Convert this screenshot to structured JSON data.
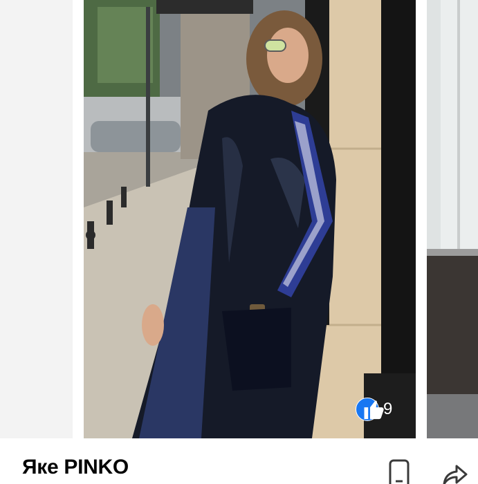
{
  "listing": {
    "title": "Яке PINKO",
    "likes": "9"
  },
  "icons": {
    "like": "thumbs-up-icon",
    "message": "phone-message-icon",
    "share": "share-arrow-icon"
  },
  "colors": {
    "like_badge": "#1877f2",
    "title_text": "#050505",
    "icon_stroke": "#3a3a3a"
  }
}
